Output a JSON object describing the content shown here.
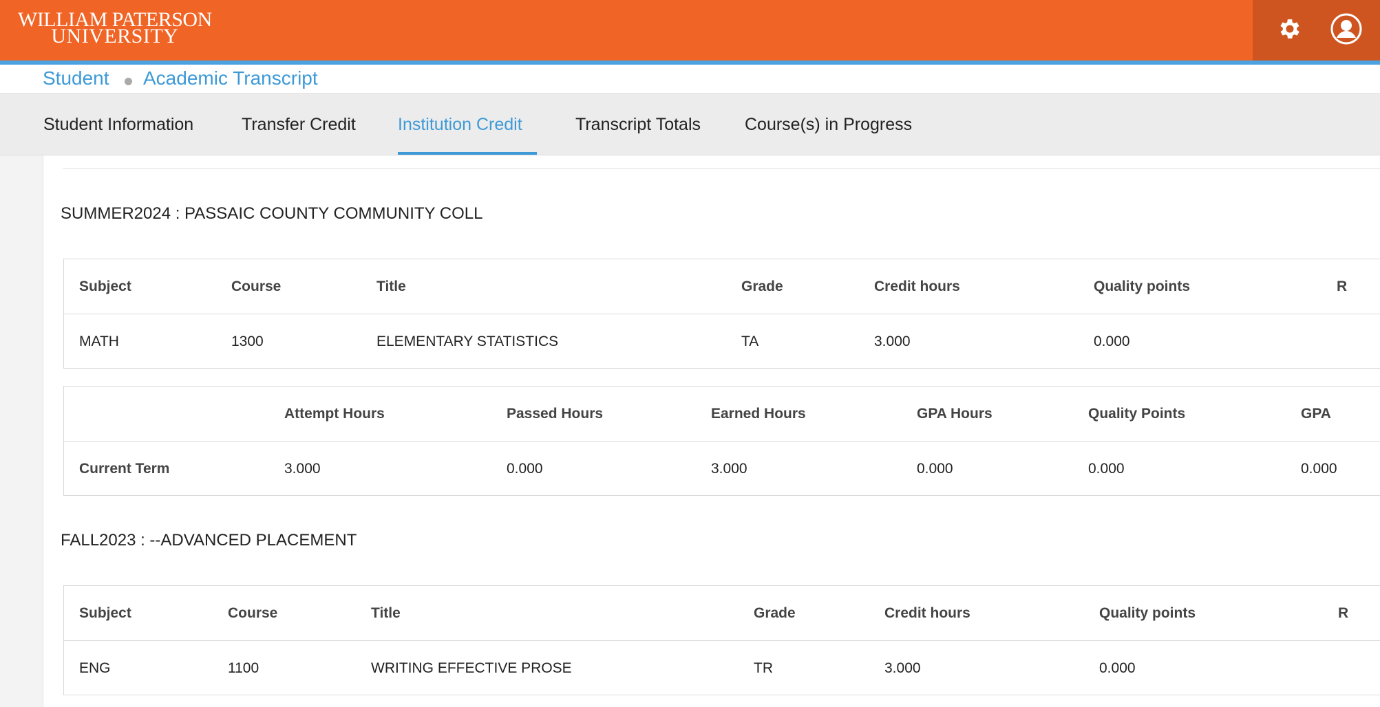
{
  "header": {
    "logo_line1": "WILLIAM PATERSON",
    "logo_line2": "UNIVERSITY",
    "settings_icon": "gear-icon",
    "user_icon": "user-avatar-icon",
    "brand_color": "#f06426",
    "accent_color": "#3d9ad7"
  },
  "breadcrumb": {
    "item1": "Student",
    "item2": "Academic Transcript"
  },
  "tabs": [
    {
      "label": "Student Information"
    },
    {
      "label": "Transfer Credit"
    },
    {
      "label": "Institution Credit",
      "active": true
    },
    {
      "label": "Transcript Totals"
    },
    {
      "label": "Course(s) in Progress"
    }
  ],
  "terms": [
    {
      "heading": "SUMMER2024 : PASSAIC COUNTY COMMUNITY COLL",
      "course_headers": [
        "Subject",
        "Course",
        "Title",
        "Grade",
        "Credit hours",
        "Quality points",
        "R"
      ],
      "courses": [
        {
          "subject": "MATH",
          "course": "1300",
          "title": "ELEMENTARY STATISTICS",
          "grade": "TA",
          "credit_hours": "3.000",
          "quality_points": "0.000",
          "r": ""
        }
      ],
      "totals_headers": [
        "",
        "Attempt Hours",
        "Passed Hours",
        "Earned Hours",
        "GPA Hours",
        "Quality Points",
        "GPA"
      ],
      "totals": [
        {
          "label": "Current Term",
          "attempt": "3.000",
          "passed": "0.000",
          "earned": "3.000",
          "gpa_hours": "0.000",
          "quality_points": "0.000",
          "gpa": "0.000"
        }
      ]
    },
    {
      "heading": "FALL2023 : --ADVANCED PLACEMENT",
      "course_headers": [
        "Subject",
        "Course",
        "Title",
        "Grade",
        "Credit hours",
        "Quality points",
        "R"
      ],
      "courses": [
        {
          "subject": "ENG",
          "course": "1100",
          "title": "WRITING EFFECTIVE PROSE",
          "grade": "TR",
          "credit_hours": "3.000",
          "quality_points": "0.000",
          "r": ""
        }
      ]
    }
  ]
}
